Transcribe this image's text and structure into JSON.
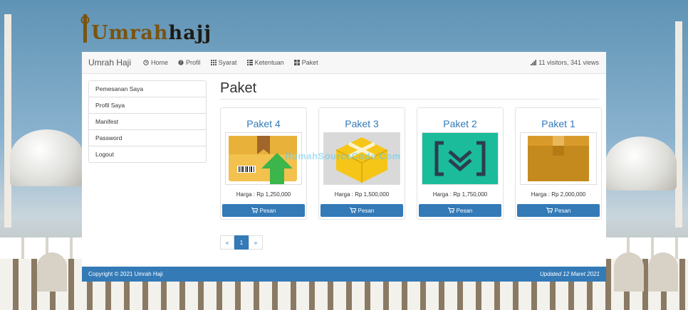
{
  "logo": {
    "text_main": "Umrah",
    "text_sub": "hajj"
  },
  "navbar": {
    "brand": "Umrah Haji",
    "items": [
      {
        "label": "Home",
        "icon": "clock-icon"
      },
      {
        "label": "Profil",
        "icon": "question-icon"
      },
      {
        "label": "Syarat",
        "icon": "grid-icon"
      },
      {
        "label": "Ketentuan",
        "icon": "list-icon"
      },
      {
        "label": "Paket",
        "icon": "tiles-icon"
      }
    ],
    "stats": "11 visitors, 341 views"
  },
  "sidebar": {
    "items": [
      {
        "label": "Pemesanan Saya"
      },
      {
        "label": "Profil Saya"
      },
      {
        "label": "Manifest"
      },
      {
        "label": "Password"
      },
      {
        "label": "Logout"
      }
    ]
  },
  "main": {
    "title": "Paket",
    "packages": [
      {
        "name": "Paket 4",
        "price": "Harga : Rp 1,250,000",
        "button": "Pesan"
      },
      {
        "name": "Paket 3",
        "price": "Harga : Rp 1,500,000",
        "button": "Pesan"
      },
      {
        "name": "Paket 2",
        "price": "Harga : Rp 1,750,000",
        "button": "Pesan"
      },
      {
        "name": "Paket 1",
        "price": "Harga : Rp 2,000,000",
        "button": "Pesan"
      }
    ],
    "pagination": {
      "prev": "«",
      "current": "1",
      "next": "»"
    }
  },
  "watermark": "RumahSourceCode.Com",
  "footer": {
    "left": "Copyright © 2021 Umrah Haji",
    "right": "Updated 12 Maret 2021"
  },
  "colors": {
    "primary": "#337ab7",
    "logo_gold": "#7a5410"
  }
}
